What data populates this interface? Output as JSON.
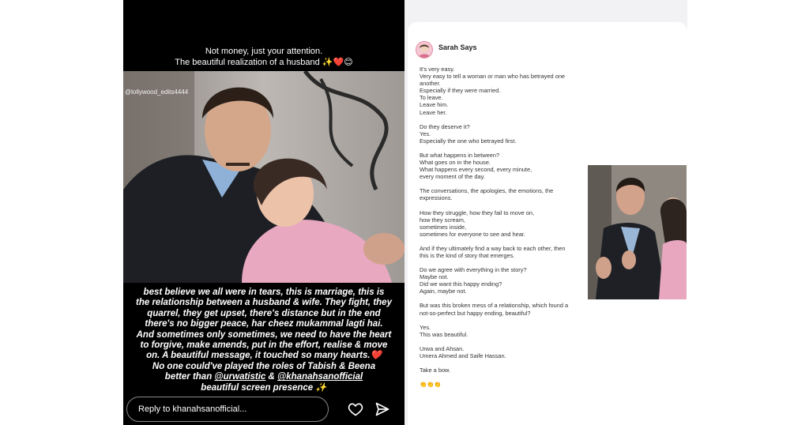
{
  "story": {
    "caption": [
      "Not money, just your attention.",
      "The beautiful realization of a husband ✨❤️😊"
    ],
    "watermark": "@lollywood_edits4444",
    "paragraphs": [
      "best believe we all were in tears, this is marriage, this is the relationship between a husband & wife. They fight, they quarrel, they get upset, there's distance but in the end there's no bigger peace, har cheez mukammal lagti hai.",
      "And sometimes only sometimes, we need to have the heart to forgive, make amends, put in the effort, realise & move on. A beautiful message, it touched so many hearts.❤️",
      "No one could've played the roles of Tabish & Beena"
    ],
    "credit": {
      "prefix": "better than",
      "mention1": "@urwatistic",
      "joiner": "&",
      "mention2": "@khanahsanofficial",
      "suffix": "beautiful screen presence ✨"
    },
    "reply_placeholder": "Reply to khanahsanofficial...",
    "icons": {
      "like": "heart-icon",
      "share": "send-icon"
    }
  },
  "post": {
    "author": "Sarah Says",
    "lines": [
      "It's very easy.",
      "Very easy to tell a woman or man who has betrayed one",
      "another.",
      "Especially if they were married.",
      "To leave.",
      "Leave him.",
      "Leave her.",
      "",
      "Do they deserve it?",
      "Yes.",
      "Especially the one who betrayed first.",
      "",
      "But what happens in between?",
      "What goes on in the house.",
      "What happens every second, every minute,",
      "every moment of the day.",
      "",
      "The conversations, the apologies, the emotions, the",
      "expressions.",
      "",
      "How they struggle, how they fail to move on,",
      "how they scream,",
      "sometimes inside,",
      "sometimes for everyone to see and hear.",
      "",
      "And if they ultimately find a way back to each other, then",
      "this is the kind of story that emerges.",
      "",
      "Do we agree with everything in the story?",
      "Maybe not.",
      "Did we want this happy ending?",
      "Again, maybe not.",
      "",
      "But was this broken mess of a relationship, which found a",
      "not-so-perfect but happy ending, beautiful?",
      "",
      "Yes.",
      "This was beautiful.",
      "",
      "Urwa and Ahsan.",
      "Umera Ahmed and Saife Hassan.",
      "",
      "Take a bow.",
      "",
      "👏👏👏"
    ]
  }
}
